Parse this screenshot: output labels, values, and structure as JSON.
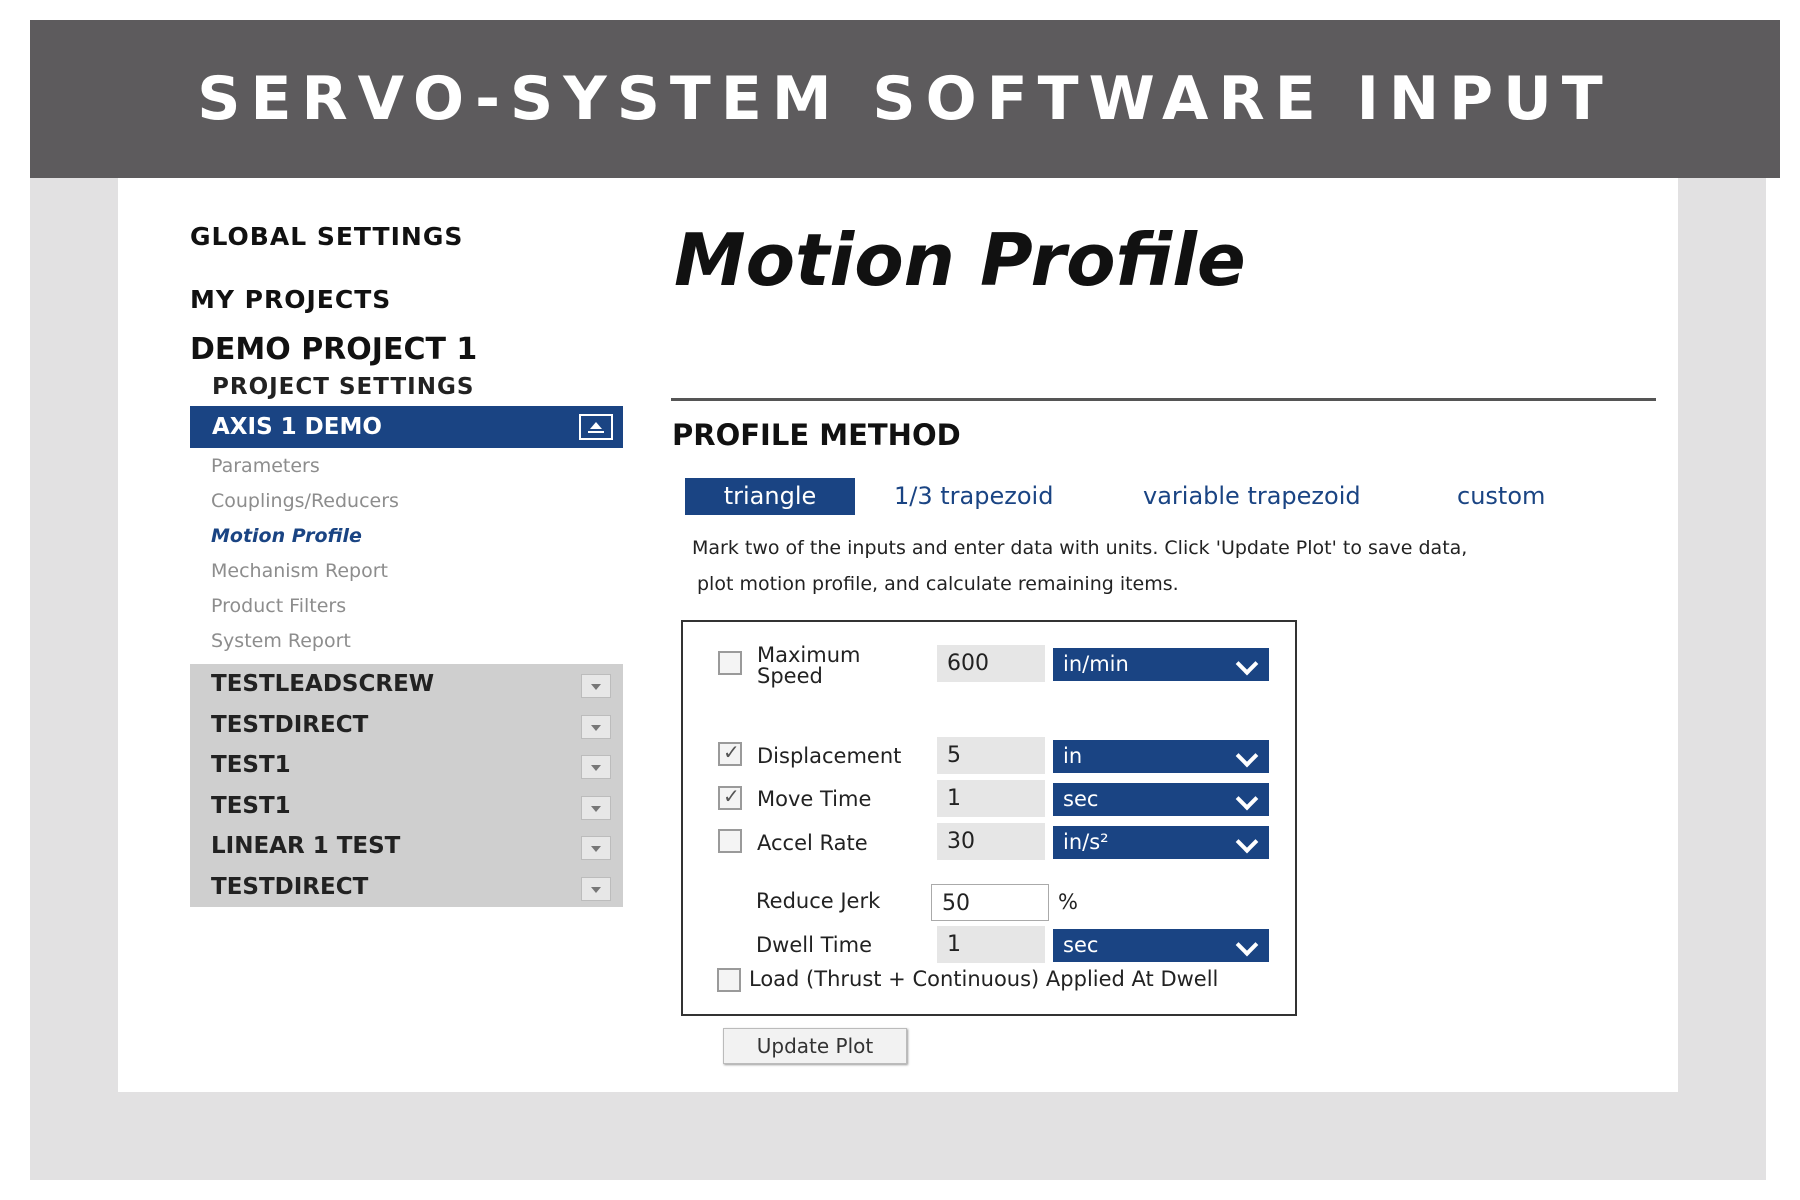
{
  "banner": {
    "title": "SERVO-SYSTEM SOFTWARE INPUT"
  },
  "sidebar": {
    "global_settings": "GLOBAL SETTINGS",
    "my_projects": "MY PROJECTS",
    "demo_project": "DEMO PROJECT 1",
    "project_settings": "PROJECT SETTINGS",
    "axis": {
      "label": "AXIS 1 DEMO",
      "icon": "collapse-icon"
    },
    "sub_items": [
      {
        "label": "Parameters",
        "active": false
      },
      {
        "label": "Couplings/Reducers",
        "active": false
      },
      {
        "label": "Motion Profile",
        "active": true
      },
      {
        "label": "Mechanism Report",
        "active": false
      },
      {
        "label": "Product Filters",
        "active": false
      },
      {
        "label": "System Report",
        "active": false
      }
    ],
    "projects": [
      {
        "label": "TESTLEADSCREW"
      },
      {
        "label": "TESTDIRECT"
      },
      {
        "label": "TEST1"
      },
      {
        "label": "TEST1"
      },
      {
        "label": "LINEAR 1 TEST"
      },
      {
        "label": "TESTDIRECT"
      }
    ]
  },
  "main": {
    "title": "Motion Profile",
    "section_title": "PROFILE METHOD",
    "tabs": [
      {
        "label": "triangle",
        "active": true
      },
      {
        "label": "1/3 trapezoid",
        "active": false
      },
      {
        "label": "variable trapezoid",
        "active": false
      },
      {
        "label": "custom",
        "active": false
      }
    ],
    "instructions": {
      "line1": "Mark two of the inputs and enter data with units. Click 'Update Plot' to save data,",
      "line2": "plot motion profile, and calculate remaining items."
    },
    "form": {
      "max_speed": {
        "label_line1": "Maximum",
        "label_line2": "Speed",
        "checked": false,
        "value": "600",
        "unit": "in/min"
      },
      "displacement": {
        "label": "Displacement",
        "checked": true,
        "value": "5",
        "unit": "in"
      },
      "move_time": {
        "label": "Move Time",
        "checked": true,
        "value": "1",
        "unit": "sec"
      },
      "accel_rate": {
        "label": "Accel Rate",
        "checked": false,
        "value": "30",
        "unit": "in/s²"
      },
      "reduce_jerk": {
        "label": "Reduce Jerk",
        "value": "50",
        "unit": "%"
      },
      "dwell_time": {
        "label": "Dwell Time",
        "value": "1",
        "unit": "sec"
      },
      "load_at_dwell": {
        "label": "Load (Thrust + Continuous) Applied At Dwell",
        "checked": false
      }
    },
    "update_button": "Update Plot"
  },
  "colors": {
    "banner": "#5d5b5d",
    "accent": "#1a4483",
    "frame": "#e2e1e2",
    "project_list_bg": "#cfcfcf"
  }
}
